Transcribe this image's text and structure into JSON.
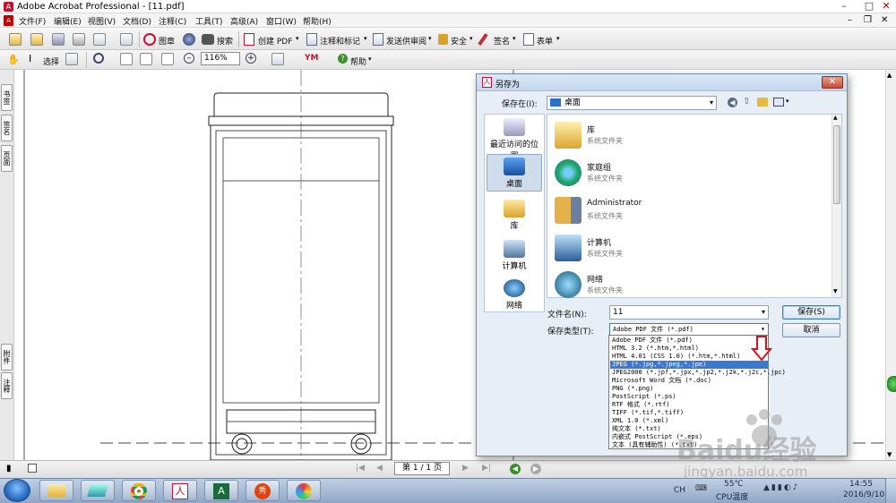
{
  "window": {
    "title": "Adobe Acrobat Professional - [11.pdf]",
    "app_icon": "acrobat-icon"
  },
  "menu": [
    "文件(F)",
    "编辑(E)",
    "视图(V)",
    "文档(D)",
    "注释(C)",
    "工具(T)",
    "高级(A)",
    "窗口(W)",
    "帮助(H)"
  ],
  "toolbar1": {
    "stamp_label": "图章",
    "search_label": "搜索",
    "create_pdf_label": "创建 PDF",
    "comment_label": "注释和标记",
    "review_label": "发送供审阅",
    "security_label": "安全",
    "sign_label": "签名",
    "forms_label": "表单"
  },
  "toolbar2": {
    "select_label": "选择",
    "zoom_value": "116%",
    "help_label": "帮助"
  },
  "left_tabs": [
    "书签",
    "签名",
    "页面",
    "附件",
    "注释"
  ],
  "navbar": {
    "page_text": "第 1 / 1 页"
  },
  "dialog": {
    "title": "另存为",
    "save_in_label": "保存在(I):",
    "save_in_value": "桌面",
    "places": [
      "最近访问的位置",
      "桌面",
      "库",
      "计算机",
      "网络"
    ],
    "files": [
      {
        "name": "库",
        "type": "系统文件夹"
      },
      {
        "name": "家庭组",
        "type": "系统文件夹"
      },
      {
        "name": "Administrator",
        "type": "系统文件夹"
      },
      {
        "name": "计算机",
        "type": "系统文件夹"
      },
      {
        "name": "网络",
        "type": "系统文件夹"
      }
    ],
    "filename_label": "文件名(N):",
    "filename_value": "11",
    "filetype_label": "保存类型(T):",
    "filetype_value": "Adobe PDF 文件 (*.pdf)",
    "save_button": "保存(S)",
    "cancel_button": "取消"
  },
  "filetype_options": [
    "Adobe PDF 文件 (*.pdf)",
    "HTML 3.2 (*.htm,*.html)",
    "HTML 4.01 (CSS 1.0) (*.htm,*.html)",
    "JPEG (*.jpg,*.jpeg,*.jpe)",
    "JPEG2000 (*.jpf,*.jpx,*.jp2,*.j2k,*.j2c,*.jpc)",
    "Microsoft Word 文档 (*.doc)",
    "PNG (*.png)",
    "PostScript (*.ps)",
    "RTF 格式 (*.rtf)",
    "TIFF (*.tif,*.tiff)",
    "XML 1.0 (*.xml)",
    "纯文本 (*.txt)",
    "内嵌式 PostScript (*.eps)",
    "文本 (具有辅助性) (*.txt)"
  ],
  "selected_filetype_index": 3,
  "taskbar": {
    "lang": "CH",
    "temp": "55℃",
    "temp_label": "CPU温度",
    "time": "14:55",
    "date": "2016/9/10"
  },
  "watermark": {
    "brand": "Baidu经验",
    "url": "jingyan.baidu.com"
  }
}
